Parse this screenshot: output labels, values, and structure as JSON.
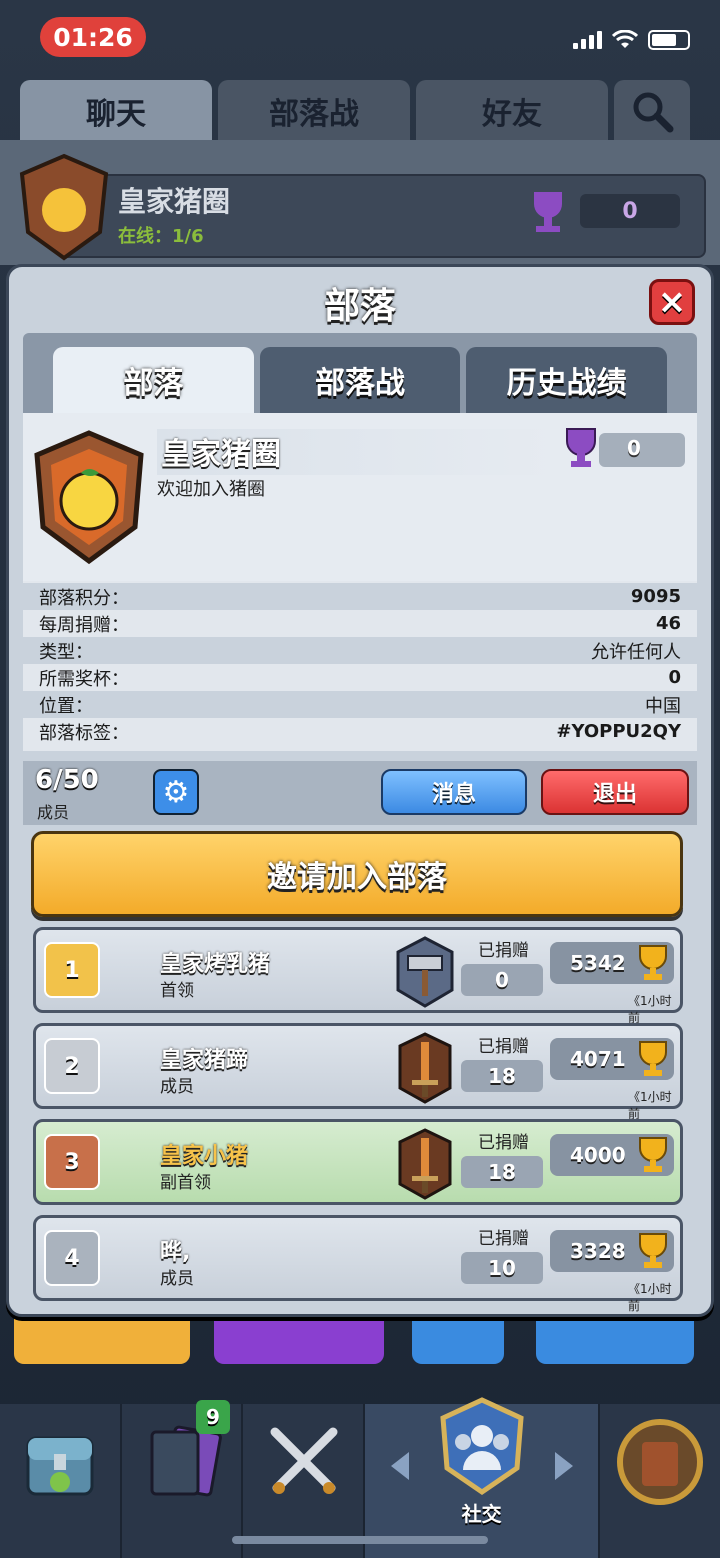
{
  "status_bar": {
    "time": "01:26"
  },
  "top_tabs": [
    "聊天",
    "部落战",
    "好友"
  ],
  "background_clan": {
    "name": "皇家猪圈",
    "online": "在线：1/6",
    "trophies": "0"
  },
  "modal": {
    "title": "部落",
    "close_label": "×",
    "tabs": [
      "部落",
      "部落战",
      "历史战绩"
    ],
    "clan": {
      "name": "皇家猪圈",
      "description": "欢迎加入猪圈",
      "trophies": "0"
    },
    "stats": [
      {
        "label": "部落积分：",
        "value": "9095"
      },
      {
        "label": "每周捐赠：",
        "value": "46"
      },
      {
        "label": "类型：",
        "value": "允许任何人"
      },
      {
        "label": "所需奖杯：",
        "value": "0"
      },
      {
        "label": "位置：",
        "value": "中国"
      },
      {
        "label": "部落标签：",
        "value": "#YOPPU2QY"
      }
    ],
    "member_count": "6/50",
    "member_count_label": "成员",
    "message_button": "消息",
    "leave_button": "退出",
    "invite_button": "邀请加入部落",
    "donated_label": "已捐赠",
    "members": [
      {
        "rank": "1",
        "name": "皇家烤乳猪",
        "role": "首领",
        "donated": "0",
        "trophies": "5342",
        "last_seen": "《1小时前"
      },
      {
        "rank": "2",
        "name": "皇家猪蹄",
        "role": "成员",
        "donated": "18",
        "trophies": "4071",
        "last_seen": "《1小时前"
      },
      {
        "rank": "3",
        "name": "皇家小猪",
        "role": "副首领",
        "donated": "18",
        "trophies": "4000",
        "last_seen": ""
      },
      {
        "rank": "4",
        "name": "晔,",
        "role": "成员",
        "donated": "10",
        "trophies": "3328",
        "last_seen": "《1小时前"
      }
    ]
  },
  "bottom_nav": {
    "social_label": "社交",
    "cards_badge": "9"
  },
  "colors": {
    "accent_gold": "#f3ab2a",
    "danger": "#db3333",
    "primary": "#3c8ae3",
    "highlight_green": "#b8dcae"
  }
}
